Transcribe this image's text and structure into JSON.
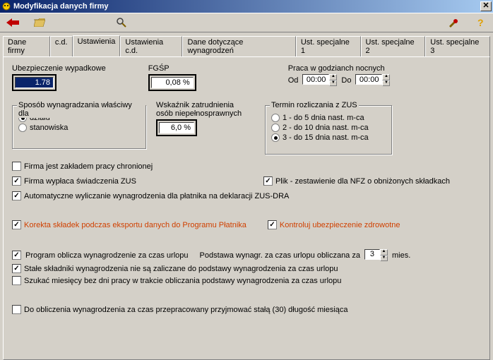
{
  "window": {
    "title": "Modyfikacja danych firmy"
  },
  "tabs": {
    "t0": "Dane firmy",
    "t1": "c.d.",
    "t2": "Ustawienia",
    "t3": "Ustawienia c.d.",
    "t4": "Dane dotyczące wynagrodzeń",
    "t5": "Ust. specjalne 1",
    "t6": "Ust. specjalne 2",
    "t7": "Ust. specjalne 3"
  },
  "ubezp": {
    "label": "Ubezpieczenie wypadkowe",
    "value": "1.78"
  },
  "fgsp": {
    "label": "FGŚP",
    "value": "0,08 %"
  },
  "nocne": {
    "label": "Praca w godzianch nocnych",
    "od_label": "Od",
    "od": "00:00",
    "do_label": "Do",
    "do": "00:00"
  },
  "sposob": {
    "title": "Sposób wynagradzania  właściwy dla",
    "opt1": "działu",
    "opt2": "stanowiska"
  },
  "wskaznik": {
    "label1": "Wskaźnik zatrudnienia",
    "label2": "osób niepełnosprawnych",
    "value": "6,0 %"
  },
  "termin": {
    "title": "Termin rozliczania z ZUS",
    "opt1": "1 - do   5 dnia nast. m-ca",
    "opt2": "2 - do 10 dnia nast. m-ca",
    "opt3": "3 - do 15 dnia nast. m-ca"
  },
  "chk": {
    "c1": "Firma jest zakładem pracy chronionej",
    "c2": "Firma wypłaca świadczenia ZUS",
    "c3": "Plik - zestawienie dla NFZ o obniżonych składkach",
    "c4": "Automatyczne wyliczanie wynagrodzenia dla płatnika na deklaracji ZUS-DRA",
    "c5": "Korekta składek podczas eksportu danych do Programu Płatnika",
    "c6": "Kontroluj ubezpieczenie zdrowotne",
    "c7": "Program oblicza wynagrodzenie za czas urlopu",
    "c7_extra": "Podstawa wynagr. za czas urlopu obliczana za",
    "c7_val": "3",
    "c7_unit": "mies.",
    "c8": "Stałe składniki wynagrodzenia  nie są  zaliczane do podstawy wynagrodzenia za czas urlopu",
    "c9": "Szukać miesięcy bez dni pracy w trakcie obliczania podstawy wynagrodzenia za czas urlopu",
    "c10": "Do obliczenia wynagrodzenia za czas przepracowany przyjmować stałą (30) długość miesiąca"
  }
}
